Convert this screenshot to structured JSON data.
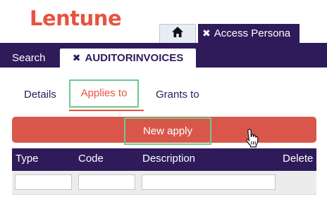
{
  "brand": {
    "logo_text": "Lentune",
    "logo_color": "#e8533f",
    "primary_color": "#2f1b5a",
    "accent_highlight": "#6dc98d"
  },
  "window_tabs": {
    "home_icon": "home-icon",
    "persona": {
      "close_glyph": "✖",
      "label": "Access Persona"
    }
  },
  "main_tabs": {
    "search_label": "Search",
    "active": {
      "close_glyph": "✖",
      "label": "AUDITORINVOICES"
    }
  },
  "sub_tabs": {
    "details": "Details",
    "applies_to": "Applies to",
    "grants_to": "Grants to",
    "selected": "Applies to"
  },
  "actions": {
    "new_apply_label": "New apply"
  },
  "grid": {
    "columns": [
      "Type",
      "Code",
      "Description",
      "Delete"
    ],
    "new_row": {
      "type": "",
      "code": "",
      "description": ""
    }
  },
  "cursor": "hand-pointer-icon"
}
